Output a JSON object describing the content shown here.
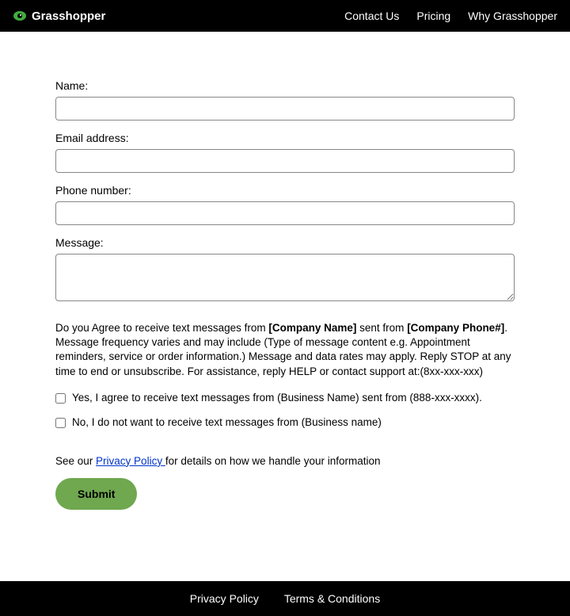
{
  "header": {
    "brand": "Grasshopper",
    "nav": {
      "contact": "Contact Us",
      "pricing": "Pricing",
      "why": "Why Grasshopper"
    }
  },
  "form": {
    "name_label": "Name:",
    "name_value": "",
    "email_label": "Email address:",
    "email_value": "",
    "phone_label": "Phone number:",
    "phone_value": "",
    "message_label": "Message:",
    "message_value": "",
    "consent": {
      "prefix": "Do you Agree to receive text messages from ",
      "company_bold": "[Company Name]",
      "mid1": " sent from ",
      "phone_bold": "[Company Phone#]",
      "rest": ". Message frequency varies and may include (Type of message content e.g. Appointment reminders, service or order information.) Message and data rates may apply. Reply STOP at any time to end or unsubscribe. For assistance, reply HELP or contact support at:(8xx-xxx-xxx)"
    },
    "checkbox_yes_label": "Yes, I agree to receive text messages from (Business Name) sent from (888-xxx-xxxx).",
    "checkbox_no_label": "No, I do not want to receive text messages from (Business name)",
    "privacy": {
      "prefix": "See our ",
      "link_text": "Privacy Policy ",
      "suffix": "for details on how we handle your information"
    },
    "submit_label": "Submit"
  },
  "footer": {
    "privacy": "Privacy Policy",
    "terms": "Terms & Conditions"
  }
}
